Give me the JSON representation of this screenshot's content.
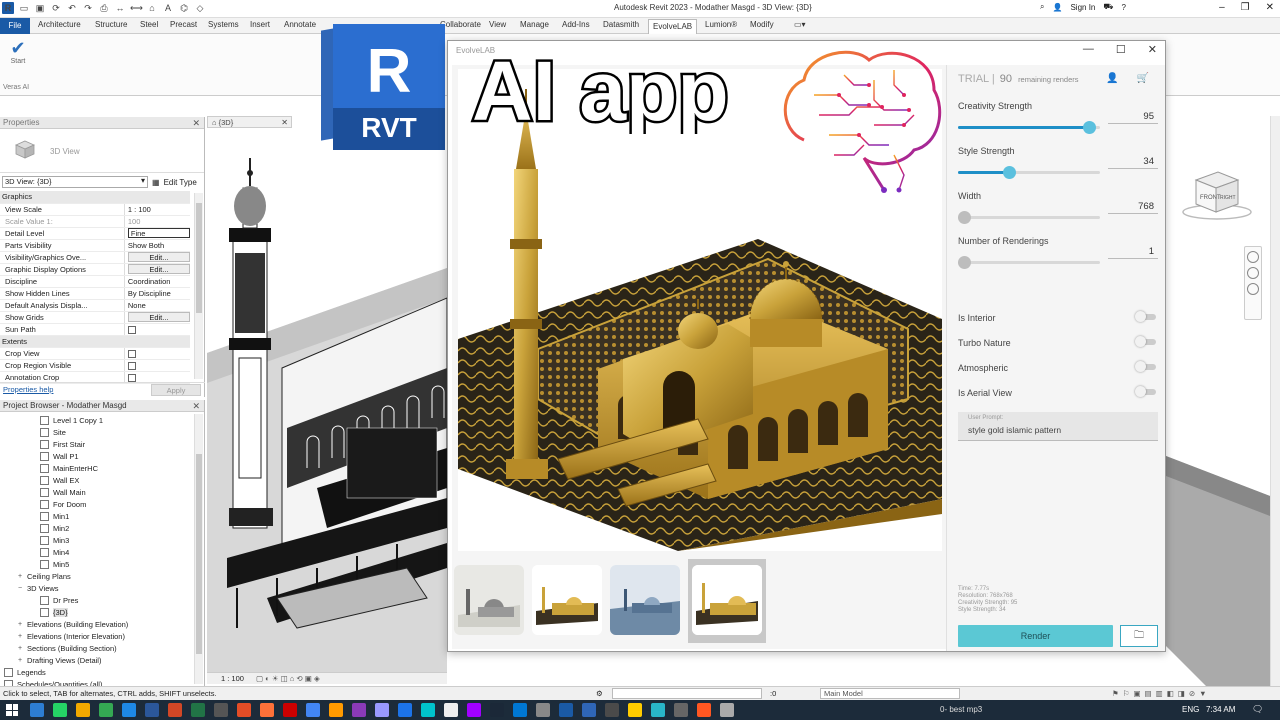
{
  "window": {
    "app_title": "Autodesk Revit 2023 - Modather Masgd - 3D View: {3D}",
    "sign_in": "Sign In"
  },
  "ribbon": {
    "file": "File",
    "tabs": [
      "Architecture",
      "Structure",
      "Steel",
      "Precast",
      "Systems",
      "Insert",
      "Annotate",
      "Collaborate",
      "View",
      "Manage",
      "Add-Ins",
      "Datasmith",
      "EvolveLAB",
      "Lumion®",
      "Modify"
    ],
    "active_tab": "EvolveLAB",
    "start_label": "Start",
    "panel_label": "Veras AI"
  },
  "properties": {
    "header": "Properties",
    "type_name": "3D View",
    "view_selector": "3D View: {3D}",
    "edit_type": "Edit Type",
    "rows": [
      {
        "group": "Graphics"
      },
      {
        "name": "View Scale",
        "value": "1 : 100"
      },
      {
        "name": "Scale Value    1:",
        "value": "100",
        "dim": true
      },
      {
        "name": "Detail Level",
        "value": "Fine",
        "field": true
      },
      {
        "name": "Parts Visibility",
        "value": "Show Both"
      },
      {
        "name": "Visibility/Graphics Ove...",
        "value": "Edit...",
        "button": true
      },
      {
        "name": "Graphic Display Options",
        "value": "Edit...",
        "button": true
      },
      {
        "name": "Discipline",
        "value": "Coordination"
      },
      {
        "name": "Show Hidden Lines",
        "value": "By Discipline"
      },
      {
        "name": "Default Analysis Displa...",
        "value": "None"
      },
      {
        "name": "Show Grids",
        "value": "Edit...",
        "button": true
      },
      {
        "name": "Sun Path",
        "value": "",
        "check": true
      },
      {
        "group": "Extents"
      },
      {
        "name": "Crop View",
        "value": "",
        "check": true
      },
      {
        "name": "Crop Region Visible",
        "value": "",
        "check": true
      },
      {
        "name": "Annotation Crop",
        "value": "",
        "check": true
      }
    ],
    "help_link": "Properties help",
    "apply": "Apply"
  },
  "browser": {
    "header": "Project Browser - Modather Masgd",
    "nodes": [
      {
        "label": "Level 1 Copy 1",
        "indent": 3,
        "icon": true
      },
      {
        "label": "Site",
        "indent": 3,
        "icon": true
      },
      {
        "label": "First Stair",
        "indent": 3,
        "icon": true
      },
      {
        "label": "Wall P1",
        "indent": 3,
        "icon": true
      },
      {
        "label": "MainEnterHC",
        "indent": 3,
        "icon": true
      },
      {
        "label": "Wall EX",
        "indent": 3,
        "icon": true
      },
      {
        "label": "Wall Main",
        "indent": 3,
        "icon": true
      },
      {
        "label": "For Doom",
        "indent": 3,
        "icon": true
      },
      {
        "label": "Min1",
        "indent": 3,
        "icon": true
      },
      {
        "label": "Min2",
        "indent": 3,
        "icon": true
      },
      {
        "label": "Min3",
        "indent": 3,
        "icon": true
      },
      {
        "label": "Min4",
        "indent": 3,
        "icon": true
      },
      {
        "label": "Min5",
        "indent": 3,
        "icon": true
      },
      {
        "label": "Ceiling Plans",
        "indent": 1,
        "exp": "+"
      },
      {
        "label": "3D Views",
        "indent": 1,
        "exp": "−"
      },
      {
        "label": "Dr Pres",
        "indent": 3,
        "icon": true
      },
      {
        "label": "{3D}",
        "indent": 3,
        "icon": true,
        "selected": true
      },
      {
        "label": "Elevations (Building Elevation)",
        "indent": 1,
        "exp": "+"
      },
      {
        "label": "Elevations (Interior Elevation)",
        "indent": 1,
        "exp": "+"
      },
      {
        "label": "Sections (Building Section)",
        "indent": 1,
        "exp": "+"
      },
      {
        "label": "Drafting Views (Detail)",
        "indent": 1,
        "exp": "+"
      },
      {
        "label": "Legends",
        "indent": 0,
        "icon": true
      },
      {
        "label": "Schedules/Quantities (all)",
        "indent": 0,
        "icon": true
      }
    ]
  },
  "view3d": {
    "tab_label": "{3D}",
    "scale": "1 : 100",
    "viewcube_labels": [
      "FRONT",
      "RIGHT"
    ]
  },
  "overlay": {
    "rvt_letter": "R",
    "rvt_label": "RVT",
    "headline": "AI app"
  },
  "dialog": {
    "title": "EvolveLAB",
    "trial_label": "TRIAL |",
    "remaining_count": "90",
    "remaining_label": "remaining renders",
    "sliders": [
      {
        "label": "Creativity Strength",
        "value": "95",
        "fraction": 0.92,
        "active": true
      },
      {
        "label": "Style Strength",
        "value": "34",
        "fraction": 0.36,
        "active": true
      },
      {
        "label": "Width",
        "value": "768",
        "fraction": 0.0,
        "active": false
      },
      {
        "label": "Number of Renderings",
        "value": "1",
        "fraction": 0.0,
        "active": false
      }
    ],
    "toggles": [
      "Is Interior",
      "Turbo Nature",
      "Atmospheric",
      "Is Aerial View"
    ],
    "prompt_label": "User Prompt:",
    "prompt_text": "style gold islamic pattern",
    "stats": [
      "Time: 7.77s",
      "Resolution: 768x768",
      "Creativity Strength: 95",
      "Style Strength: 34"
    ],
    "render_label": "Render",
    "thumbnails": [
      "sketch-white",
      "gold-small",
      "blue-snow",
      "gold-selected"
    ],
    "selected_thumbnail": 3
  },
  "statusbar": {
    "hint": "Click to select, TAB for alternates, CTRL adds, SHIFT unselects.",
    "zero": ":0",
    "model": "Main Model"
  },
  "taskbar": {
    "music": "0- best mp3",
    "lang": "ENG",
    "time": "7:34 AM"
  },
  "colors": {
    "revit_blue": "#1a5aa6",
    "accent_teal": "#5bc8d4",
    "slider_fill": "#1e8fc7",
    "gold": "#c9a23a"
  }
}
